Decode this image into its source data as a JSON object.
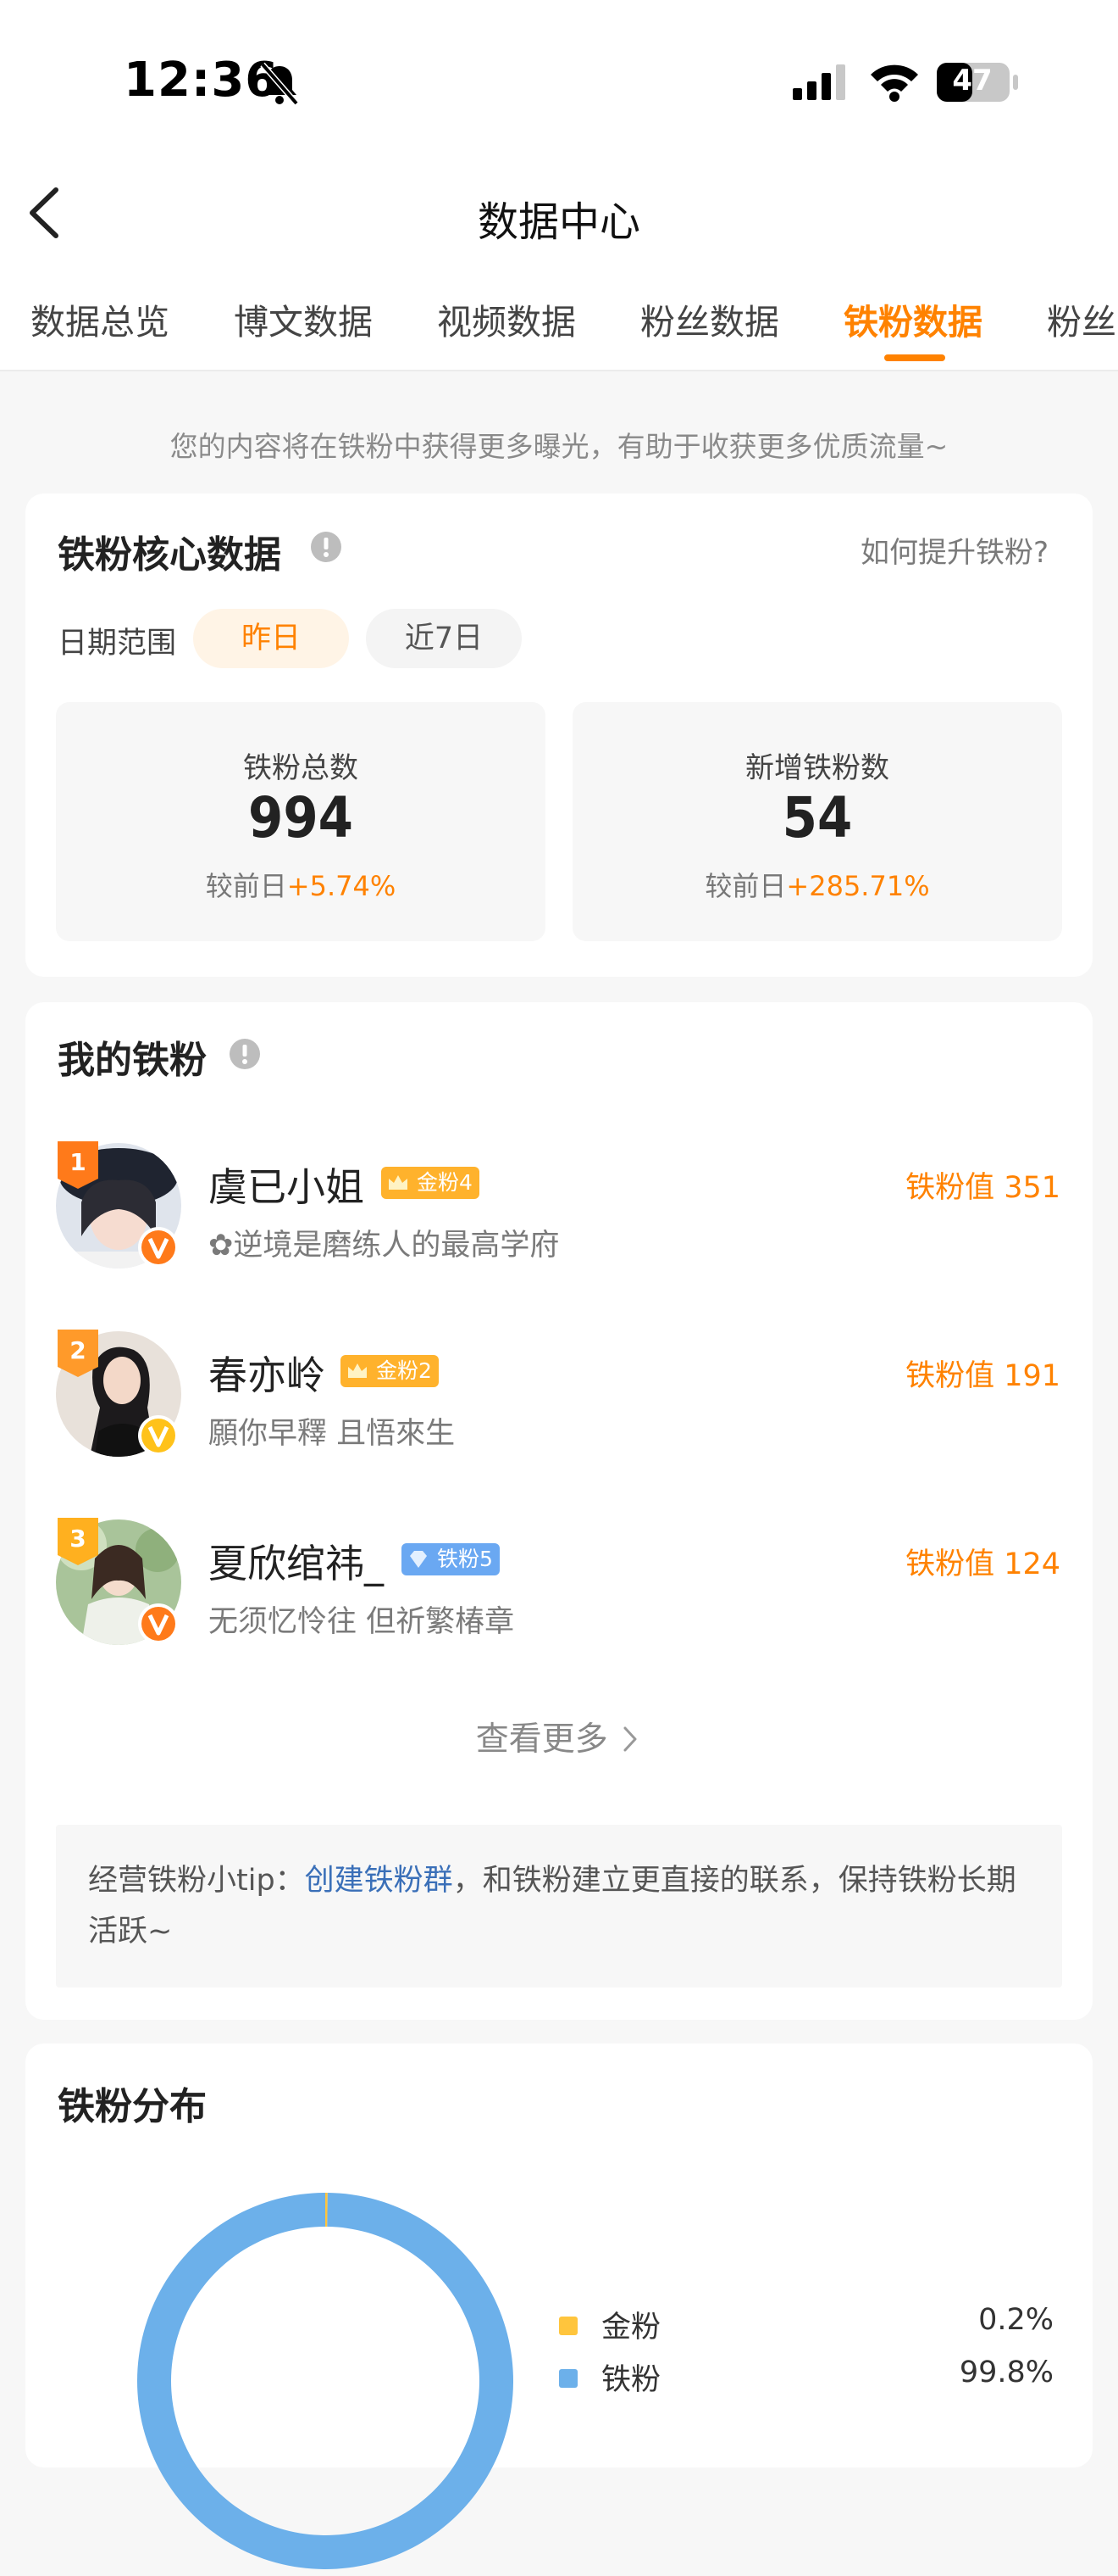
{
  "status_bar": {
    "time": "12:36",
    "battery": "47"
  },
  "header": {
    "title": "数据中心"
  },
  "tabs": [
    {
      "label": "数据总览"
    },
    {
      "label": "博文数据"
    },
    {
      "label": "视频数据"
    },
    {
      "label": "粉丝数据"
    },
    {
      "label": "铁粉数据",
      "active": true
    },
    {
      "label": "粉丝"
    }
  ],
  "notice": "您的内容将在铁粉中获得更多曝光，有助于收获更多优质流量~",
  "core": {
    "title": "铁粉核心数据",
    "help_link": "如何提升铁粉?",
    "date_label": "日期范围",
    "date_options": [
      "昨日",
      "近7日"
    ],
    "selected_date": "昨日",
    "stats": [
      {
        "label": "铁粉总数",
        "value": "994",
        "compare_prefix": "较前日",
        "change": "+5.74%"
      },
      {
        "label": "新增铁粉数",
        "value": "54",
        "compare_prefix": "较前日",
        "change": "+285.71%"
      }
    ]
  },
  "fans": {
    "title": "我的铁粉",
    "list": [
      {
        "rank": "1",
        "name": "虞已小姐",
        "level": "金粉4",
        "level_type": "gold",
        "signature": "✿逆境是磨练人的最高学府",
        "value_text": "铁粉值 351"
      },
      {
        "rank": "2",
        "name": "春亦岭",
        "level": "金粉2",
        "level_type": "gold",
        "signature": "願你早釋 且悟來生",
        "value_text": "铁粉值 191"
      },
      {
        "rank": "3",
        "name": "夏欣绾祎_",
        "level": "铁粉5",
        "level_type": "iron",
        "signature": "无须忆怜往 但祈繁椿章",
        "value_text": "铁粉值 124"
      }
    ],
    "view_more": "查看更多",
    "tip_prefix": "经营铁粉小tip：",
    "tip_link": "创建铁粉群",
    "tip_suffix": "，和铁粉建立更直接的联系，保持铁粉长期活跃~"
  },
  "distribution": {
    "title": "铁粉分布",
    "colors": {
      "gold": "#ffc53d",
      "iron": "#6cb0ea"
    }
  },
  "chart_data": {
    "type": "pie",
    "categories": [
      "金粉",
      "铁粉"
    ],
    "values": [
      0.2,
      99.8
    ],
    "value_labels": [
      "0.2%",
      "99.8%"
    ],
    "title": "铁粉分布"
  }
}
